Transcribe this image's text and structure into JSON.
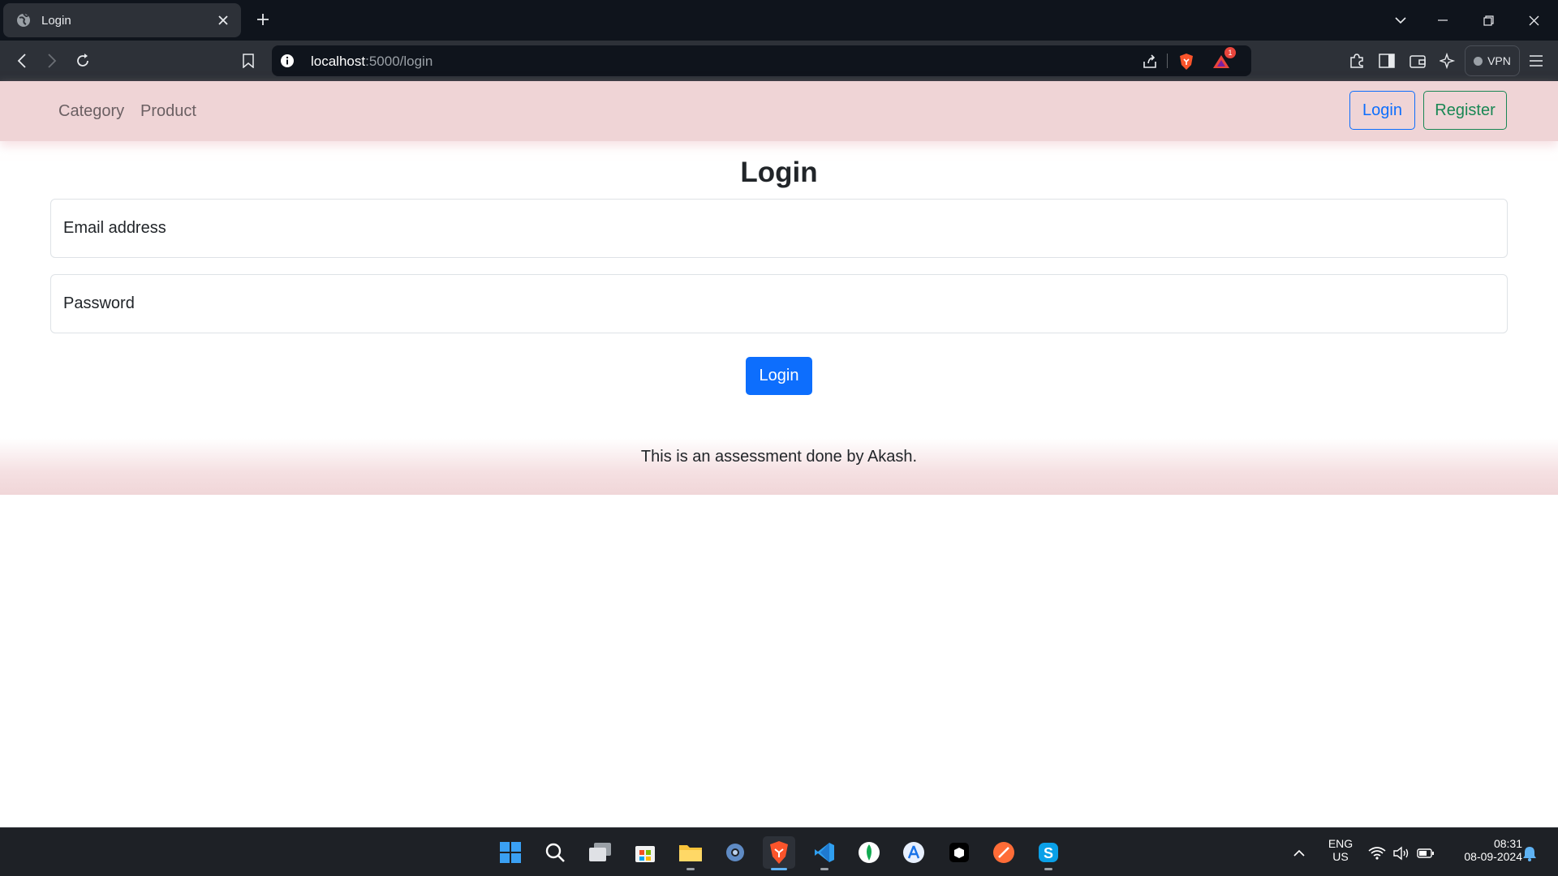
{
  "browser": {
    "tab": {
      "title": "Login",
      "icon": "globe-icon"
    },
    "url": {
      "host": "localhost",
      "path": ":5000/login"
    },
    "brave_rewards_badge": "1",
    "vpn_label": "VPN"
  },
  "navbar": {
    "links": [
      {
        "label": "Category"
      },
      {
        "label": "Product"
      }
    ],
    "login_label": "Login",
    "register_label": "Register"
  },
  "form": {
    "title": "Login",
    "email_placeholder": "Email address",
    "password_placeholder": "Password",
    "submit_label": "Login"
  },
  "footer": {
    "text": "This is an assessment done by Akash."
  },
  "taskbar": {
    "apps": [
      "windows-start-icon",
      "search-icon",
      "task-view-icon",
      "microsoft-store-icon",
      "file-explorer-icon",
      "settings-icon",
      "brave-browser-icon",
      "vscode-icon",
      "mongodb-compass-icon",
      "app-installer-icon",
      "terminal-app-icon",
      "postman-icon",
      "skype-icon"
    ],
    "language": {
      "line1": "ENG",
      "line2": "US"
    },
    "time": "08:31",
    "date": "08-09-2024"
  },
  "colors": {
    "primary": "#0d6efd",
    "success": "#198754",
    "navbar_bg": "#efd4d6"
  }
}
